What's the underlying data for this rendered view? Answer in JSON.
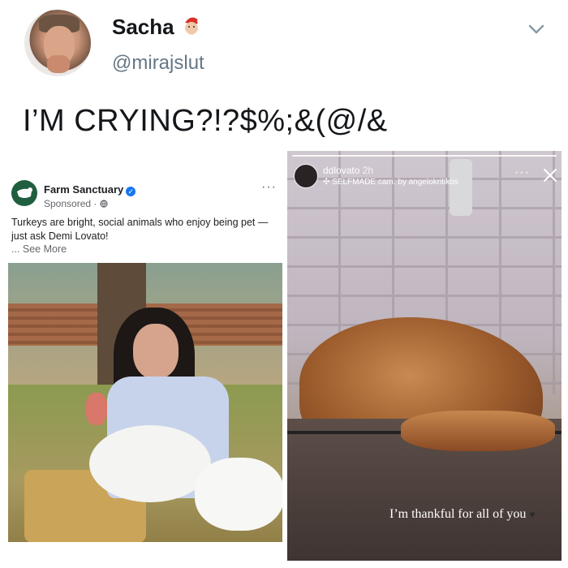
{
  "tweet": {
    "name": "Sacha",
    "name_emoji": "santa-face-icon",
    "handle": "@mirajslut",
    "text": "I’M CRYING?!?$%;&(@/&"
  },
  "fb_ad": {
    "page_name": "Farm Sanctuary",
    "verified": "✓",
    "sponsored": "Sponsored · ",
    "body": "Turkeys are bright, social animals who enjoy being pet — just ask Demi Lovato!",
    "see_more": "... See More",
    "menu_dots": "···"
  },
  "ig_story": {
    "username": "ddlovato",
    "time": "2h",
    "sub": "✣ SELFMADE cam. by angelokritikos",
    "caption": "I’m thankful for all of you",
    "heart": "♥",
    "menu_dots": "···"
  },
  "colors": {
    "text_primary": "#14171a",
    "text_secondary": "#657786",
    "fb_blue": "#1877f2",
    "farm_green": "#1f5e3f"
  }
}
